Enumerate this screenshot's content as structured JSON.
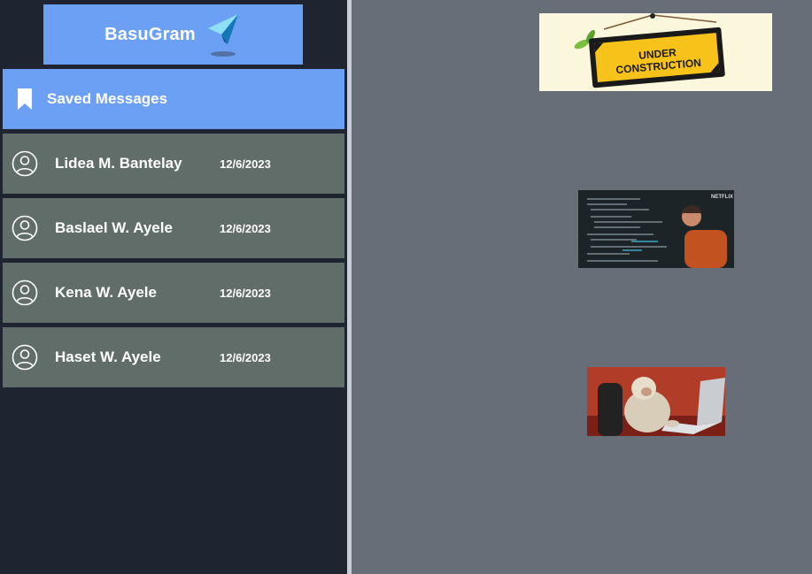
{
  "app": {
    "title": "BasuGram",
    "logo_icon": "paper-plane-icon"
  },
  "sidebar": {
    "saved": {
      "label": "Saved Messages",
      "icon": "bookmark-icon"
    },
    "chats": [
      {
        "name": "Lidea M. Bantelay",
        "date": "12/6/2023",
        "icon": "user-circle-icon"
      },
      {
        "name": "Baslael W. Ayele",
        "date": "12/6/2023",
        "icon": "user-circle-icon"
      },
      {
        "name": "Kena W. Ayele",
        "date": "12/6/2023",
        "icon": "user-circle-icon"
      },
      {
        "name": "Haset W. Ayele",
        "date": "12/6/2023",
        "icon": "user-circle-icon"
      }
    ]
  },
  "main": {
    "images": [
      {
        "kind": "under-construction-gif",
        "sign_text": "UNDER CONSTRUCTION"
      },
      {
        "kind": "coding-gif",
        "badge_text": "NETFLIX"
      },
      {
        "kind": "typing-monkey-gif"
      }
    ]
  },
  "colors": {
    "accent": "#6ca0f4",
    "sidebar_bg": "#1e2430",
    "chat_item_bg": "#616d69",
    "main_bg": "#676e78"
  }
}
